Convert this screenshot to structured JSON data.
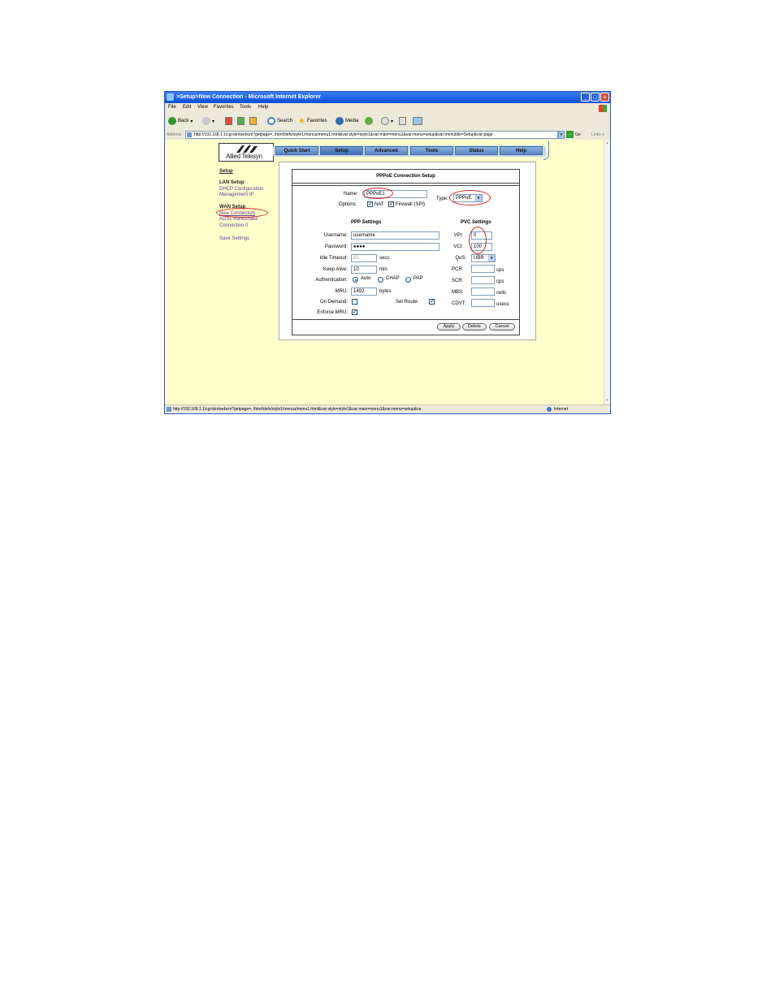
{
  "window": {
    "title": ">Setup>New Connection - Microsoft Internet Explorer",
    "controls": {
      "minimize": "_",
      "maximize": "□",
      "close": "✕"
    }
  },
  "menubar": {
    "items": [
      "File",
      "Edit",
      "View",
      "Favorites",
      "Tools",
      "Help"
    ]
  },
  "toolbar": {
    "back_label": "Back",
    "search_label": "Search",
    "favorites_label": "Favorites",
    "media_label": "Media"
  },
  "address": {
    "label": "Address",
    "url": "http://192.168.1.1/cgi-bin/webcm?getpage=../html/defs/style1/menus/menu1.html&var:style=style1&var:main=menu1&var:menu=setup&var:menutitle=Setup&var:page",
    "go_label": "Go",
    "links_label": "Links",
    "more": "»"
  },
  "statusbar": {
    "text": "http://192.168.1.1/cgi-bin/webcm?getpage=../html/defs/style1/menus/menu1.html&var:style=style1&var:main=menu1&var:menu=setup&va",
    "zone": "Internet"
  },
  "site": {
    "logo_text": "Allied Telesyn",
    "nav": [
      "Quick Start",
      "Setup",
      "Advanced",
      "Tools",
      "Status",
      "Help"
    ],
    "active_nav": "Setup"
  },
  "sidebar": {
    "setup": "Setup",
    "lan_setup": "LAN Setup",
    "dhcp": "DHCP Configuration",
    "mgmt_ip": "Management IP",
    "wan_setup": "WAN Setup",
    "new_connection": "New Connection",
    "adsl_handshake": "ADSL Handshake",
    "connection0": "Connection 0",
    "save_settings": "Save Settings"
  },
  "form": {
    "title": "PPPoE Connection Setup",
    "name_label": "Name:",
    "name_value": "PPPoE1",
    "type_label": "Type:",
    "type_value": "PPPoE",
    "options_label": "Options:",
    "nat_label": "NAT",
    "firewall_label": "Firewall (SPI)",
    "ppp_heading": "PPP Settings",
    "pvc_heading": "PVC Settings",
    "username_label": "Username:",
    "username_value": "username",
    "password_label": "Password:",
    "password_value": "●●●●",
    "idle_label": "Idle Timeout:",
    "idle_value": "60",
    "idle_unit": "secs",
    "keepalive_label": "Keep Alive:",
    "keepalive_value": "10",
    "keepalive_unit": "min",
    "auth_label": "Authentication:",
    "auth_auto": "Auto",
    "auth_chap": "CHAP",
    "auth_pap": "PAP",
    "mru_label": "MRU:",
    "mru_value": "1492",
    "mru_unit": "bytes",
    "ondemand_label": "On Demand:",
    "setroute_label": "Set Route:",
    "enforce_label": "Enforce MRU:",
    "vpi_label": "VPI:",
    "vpi_value": "0",
    "vci_label": "VCI:",
    "vci_value": "100",
    "qos_label": "QoS:",
    "qos_value": "UBR",
    "pcr_label": "PCR:",
    "pcr_unit": "cps",
    "scr_label": "SCR:",
    "scr_unit": "cps",
    "mbs_label": "MBS:",
    "mbs_unit": "cells",
    "cdvt_label": "CDVT:",
    "cdvt_unit": "usecs",
    "apply_label": "Apply",
    "delete_label": "Delete",
    "cancel_label": "Cancel"
  },
  "colors": {
    "titlebar": "#0a4fd6",
    "page_background": "#ffffcc",
    "nav_tab": "#6c98d3",
    "annotation": "#d8242c",
    "sidebar_link": "#6b3b9e"
  }
}
